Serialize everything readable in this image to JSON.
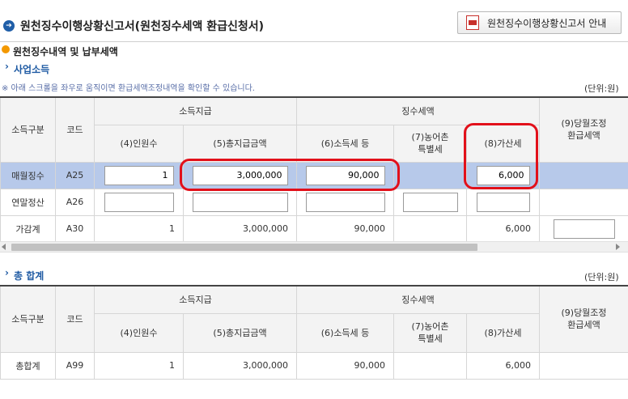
{
  "header": {
    "title": "원천징수이행상황신고서(원천징수세액 환급신청서)",
    "guide_button": "원천징수이행상황신고서 안내"
  },
  "section": {
    "title": "원천징수내역 및 납부세액"
  },
  "business": {
    "subtitle": "사업소득",
    "notice": "※ 아래 스크롤을 좌우로 움직이면 환급세액조정내역을 확인할 수 있습니다.",
    "unit": "(단위:원)"
  },
  "table_headers": {
    "category": "소득구분",
    "code": "코드",
    "income_payment": "소득지급",
    "withholding_tax": "징수세액",
    "count": "(4)인원수",
    "total_payment": "(5)총지급금액",
    "income_tax": "(6)소득세 등",
    "rural_tax_line1": "(7)농어촌",
    "rural_tax_line2": "특별세",
    "additional_tax": "(8)가산세",
    "refund_line1": "(9)당월조정",
    "refund_line2": "환급세액"
  },
  "rows": [
    {
      "category": "매월징수",
      "code": "A25",
      "count": "1",
      "total_payment": "3,000,000",
      "income_tax": "90,000",
      "rural_tax": "",
      "additional_tax": "6,000",
      "refund": ""
    },
    {
      "category": "연말정산",
      "code": "A26",
      "count": "",
      "total_payment": "",
      "income_tax": "",
      "rural_tax": "",
      "additional_tax": "",
      "refund": ""
    },
    {
      "category": "가감계",
      "code": "A30",
      "count": "1",
      "total_payment": "3,000,000",
      "income_tax": "90,000",
      "rural_tax": "",
      "additional_tax": "6,000",
      "refund": ""
    }
  ],
  "total": {
    "subtitle": "총 합계",
    "unit": "(단위:원)",
    "row": {
      "category": "총합계",
      "code": "A99",
      "count": "1",
      "total_payment": "3,000,000",
      "income_tax": "90,000",
      "rural_tax": "",
      "additional_tax": "6,000",
      "refund": ""
    }
  },
  "colors": {
    "selected_row": "#b7c9ea",
    "annotation": "#e2101a",
    "link_blue": "#1e5aa3"
  }
}
